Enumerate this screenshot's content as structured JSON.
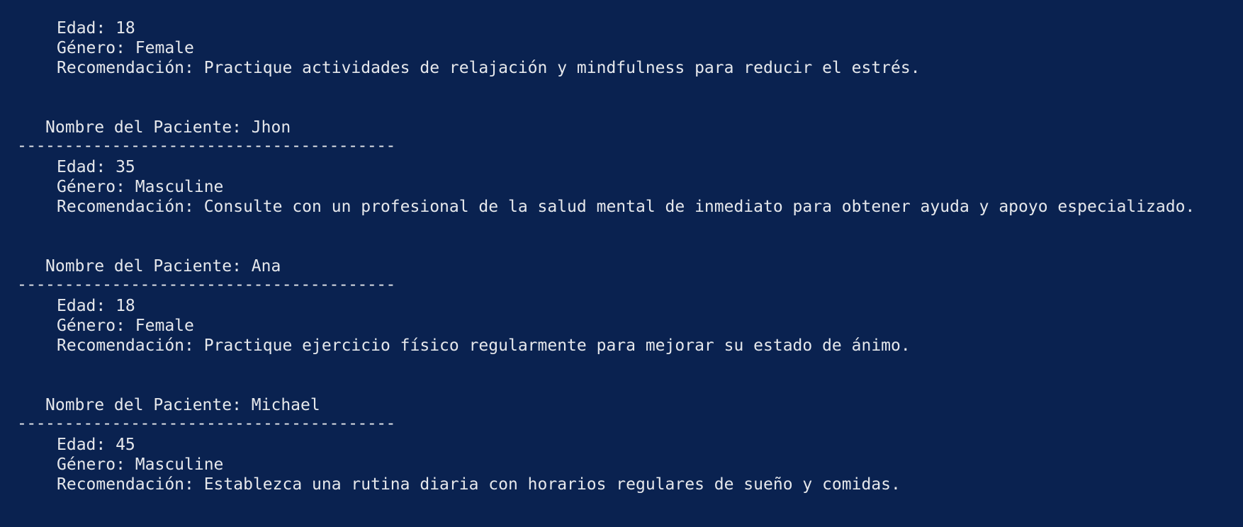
{
  "terminal": {
    "top_partial": {
      "age": "Edad: 18",
      "gender": "Género: Female",
      "recommendation": "Recomendación: Practique actividades de relajación y mindfulness para reducir el estrés."
    },
    "patients": [
      {
        "name_line": "Nombre del Paciente: Jhon",
        "separator": "----------------------------------------",
        "age": "Edad: 35",
        "gender": "Género: Masculine",
        "recommendation": "Recomendación: Consulte con un profesional de la salud mental de inmediato para obtener ayuda y apoyo especializado."
      },
      {
        "name_line": "Nombre del Paciente: Ana",
        "separator": "----------------------------------------",
        "age": "Edad: 18",
        "gender": "Género: Female",
        "recommendation": "Recomendación: Practique ejercicio físico regularmente para mejorar su estado de ánimo."
      },
      {
        "name_line": "Nombre del Paciente: Michael",
        "separator": "----------------------------------------",
        "age": "Edad: 45",
        "gender": "Género: Masculine",
        "recommendation": "Recomendación: Establezca una rutina diaria con horarios regulares de sueño y comidas."
      }
    ]
  },
  "colors": {
    "background": "#0a2250",
    "foreground": "#e6e8ec"
  }
}
